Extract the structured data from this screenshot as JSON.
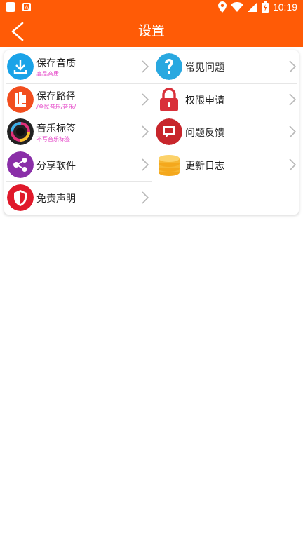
{
  "status": {
    "time": "10:19"
  },
  "appbar": {
    "title": "设置"
  },
  "left_items": [
    {
      "label": "保存音质",
      "sub": "高品音质",
      "icon": "download-icon",
      "color": "#1aa3e8"
    },
    {
      "label": "保存路径",
      "sub": "/全民音乐/音乐/",
      "icon": "folder-path-icon",
      "color": "#f24e1e"
    },
    {
      "label": "音乐标签",
      "sub": "不写音乐标签",
      "icon": "music-tag-icon",
      "color": "#222222"
    },
    {
      "label": "分享软件",
      "sub": "",
      "icon": "share-icon",
      "color": "#8a2fa8"
    },
    {
      "label": "免责声明",
      "sub": "",
      "icon": "shield-icon",
      "color": "#e0192b"
    }
  ],
  "right_items": [
    {
      "label": "常见问题",
      "icon": "question-icon",
      "color": "#29a8e0"
    },
    {
      "label": "权限申请",
      "icon": "lock-icon",
      "color": "#d9303a"
    },
    {
      "label": "问题反馈",
      "icon": "feedback-icon",
      "color": "#c8262c"
    },
    {
      "label": "更新日志",
      "icon": "coins-icon",
      "color": "#f6b633"
    }
  ]
}
